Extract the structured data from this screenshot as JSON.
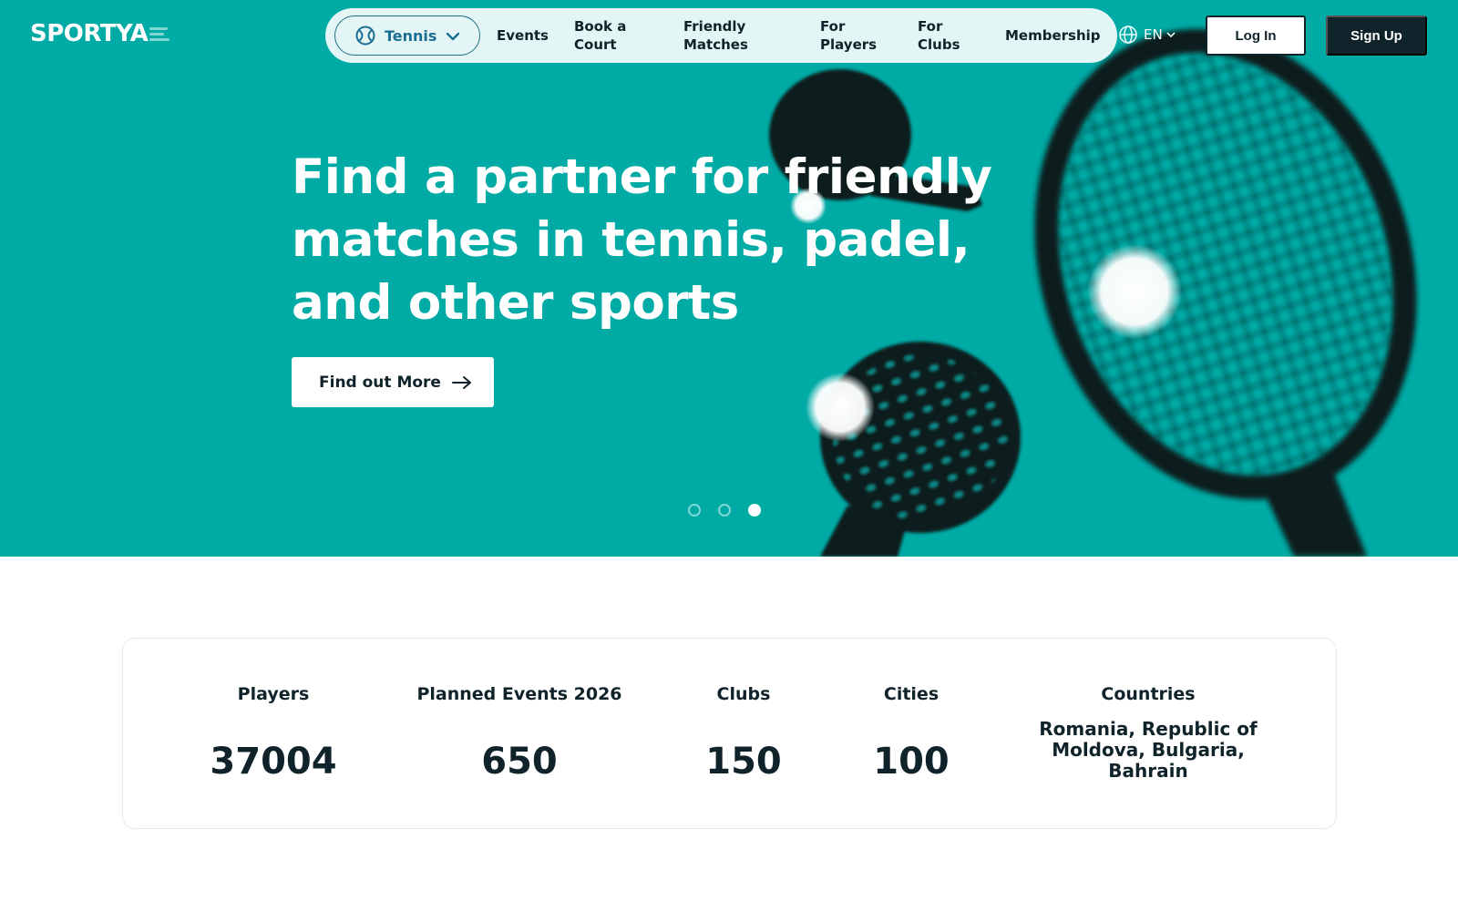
{
  "header": {
    "logo_text": "SPORTYA",
    "sport_selector": {
      "selected": "Tennis"
    },
    "nav": [
      {
        "id": "events",
        "label": "Events"
      },
      {
        "id": "book-court",
        "label": "Book a Court"
      },
      {
        "id": "friendly-matches",
        "label": "Friendly Matches"
      },
      {
        "id": "for-players",
        "label": "For Players"
      },
      {
        "id": "for-clubs",
        "label": "For Clubs"
      },
      {
        "id": "membership",
        "label": "Membership"
      }
    ],
    "language": "EN",
    "login_label": "Log In",
    "signup_label": "Sign Up"
  },
  "hero": {
    "title": "Find a partner for friendly matches in tennis, padel, and other sports",
    "cta_label": "Find out More",
    "carousel": {
      "slides": 3,
      "active_index": 2
    }
  },
  "stats": [
    {
      "label": "Players",
      "value": "37004"
    },
    {
      "label": "Planned Events 2026",
      "value": "650"
    },
    {
      "label": "Clubs",
      "value": "150"
    },
    {
      "label": "Cities",
      "value": "100"
    },
    {
      "label": "Countries",
      "value": "Romania, Republic of Moldova, Bulgaria, Bahrain"
    }
  ],
  "colors": {
    "hero_bg": "#00aaa5",
    "nav_pill_bg": "#e3f6f5",
    "dark": "#10232a",
    "accent_blue": "#1a6e93"
  },
  "icons": {
    "sport": "tennis-ball-icon",
    "dropdown": "chevron-down-icon",
    "language": "globe-icon",
    "cta": "arrow-right-icon"
  }
}
